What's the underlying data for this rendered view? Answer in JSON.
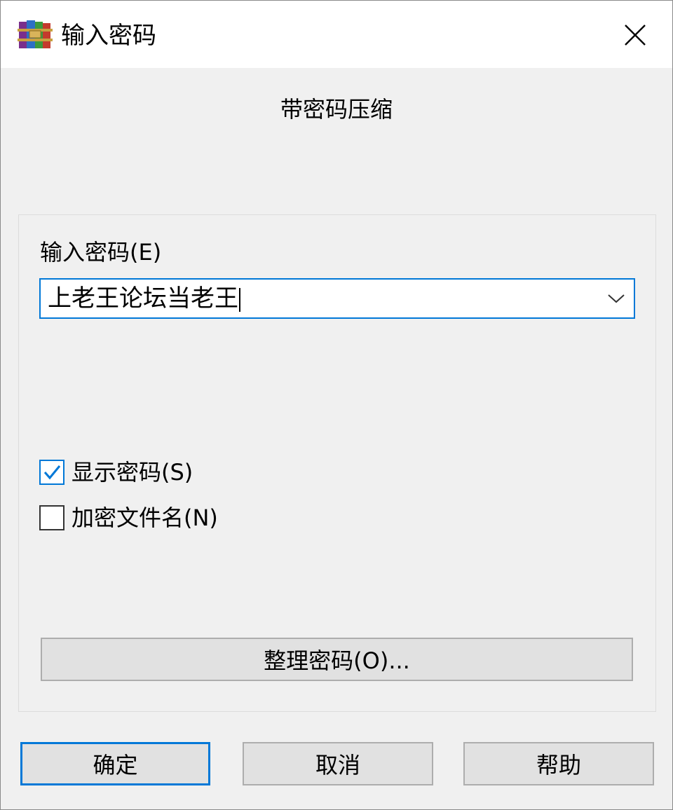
{
  "window": {
    "title": "输入密码",
    "app_icon": "winrar-books-icon",
    "close_icon": "close-icon"
  },
  "header": {
    "text": "带密码压缩"
  },
  "password": {
    "label": "输入密码(E)",
    "value": "上老王论坛当老王",
    "dropdown_icon": "chevron-down-icon"
  },
  "options": {
    "show_password": {
      "label": "显示密码(S)",
      "checked": true
    },
    "encrypt_filenames": {
      "label": "加密文件名(N)",
      "checked": false
    }
  },
  "organize_button": {
    "label": "整理密码(O)..."
  },
  "buttons": {
    "ok": "确定",
    "cancel": "取消",
    "help": "帮助"
  },
  "colors": {
    "accent": "#0078d7",
    "dialog_bg": "#f0f0f0",
    "button_bg": "#e1e1e1"
  }
}
